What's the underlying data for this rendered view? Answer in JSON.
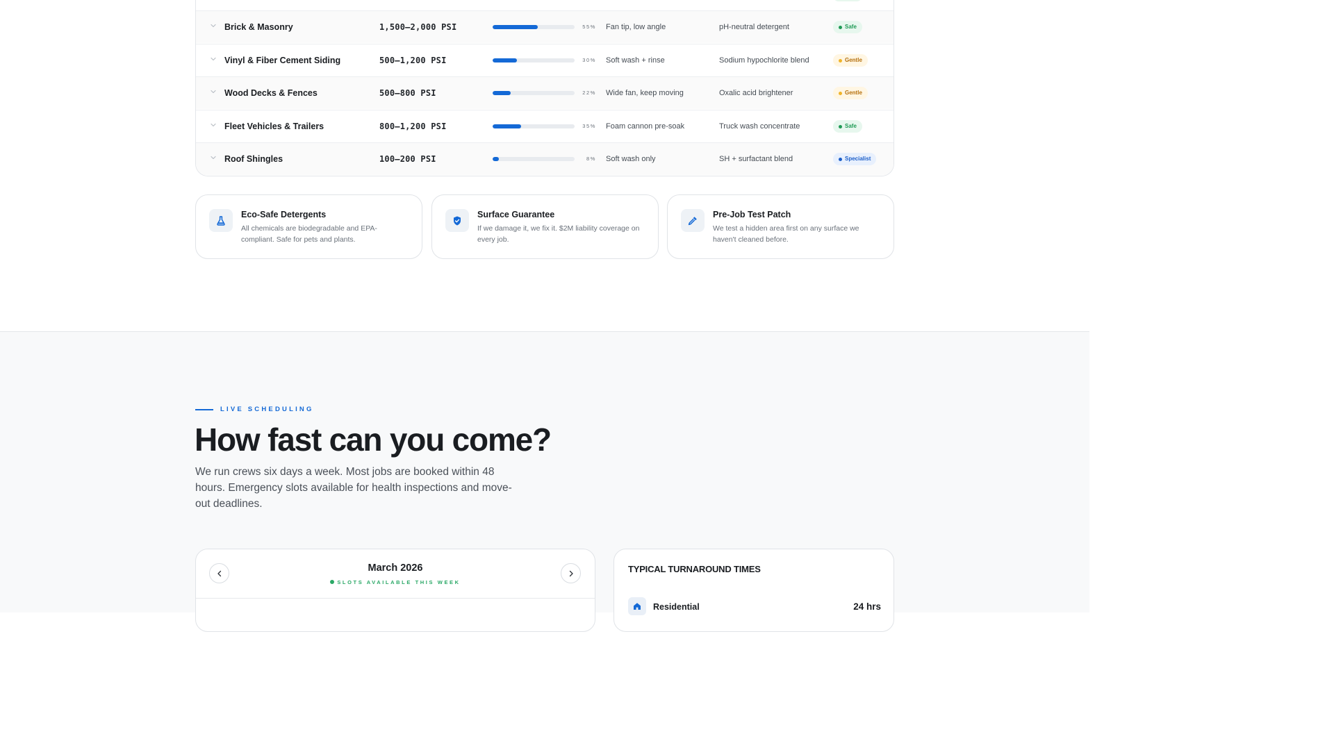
{
  "surfaces_table": {
    "rows": [
      {
        "surface": "Brick & Masonry",
        "psi": "1,500–2,000 PSI",
        "pressure_level": 55,
        "pressure_label": "55%",
        "technique": "Fan tip, low angle",
        "chemical": "pH-neutral detergent",
        "rating": "Safe",
        "rating_type": "safe"
      },
      {
        "surface": "Vinyl & Fiber Cement Siding",
        "psi": "500–1,200 PSI",
        "pressure_level": 30,
        "pressure_label": "30%",
        "technique": "Soft wash + rinse",
        "chemical": "Sodium hypochlorite blend",
        "rating": "Gentle",
        "rating_type": "gentle"
      },
      {
        "surface": "Wood Decks & Fences",
        "psi": "500–800 PSI",
        "pressure_level": 22,
        "pressure_label": "22%",
        "technique": "Wide fan, keep moving",
        "chemical": "Oxalic acid brightener",
        "rating": "Gentle",
        "rating_type": "gentle"
      },
      {
        "surface": "Fleet Vehicles & Trailers",
        "psi": "800–1,200 PSI",
        "pressure_level": 35,
        "pressure_label": "35%",
        "technique": "Foam cannon pre-soak",
        "chemical": "Truck wash concentrate",
        "rating": "Safe",
        "rating_type": "safe"
      },
      {
        "surface": "Roof Shingles",
        "psi": "100–200 PSI",
        "pressure_level": 8,
        "pressure_label": "8%",
        "technique": "Soft wash only",
        "chemical": "SH + surfactant blend",
        "rating": "Specialist",
        "rating_type": "specialist"
      }
    ]
  },
  "features": [
    {
      "icon": "flask-icon",
      "title": "Eco-Safe Detergents",
      "description": "All chemicals are biodegradable and EPA-compliant. Safe for pets and plants."
    },
    {
      "icon": "shield-icon",
      "title": "Surface Guarantee",
      "description": "If we damage it, we fix it. $2M liability coverage on every job."
    },
    {
      "icon": "dropper-icon",
      "title": "Pre-Job Test Patch",
      "description": "We test a hidden area first on any surface we haven't cleaned before."
    }
  ],
  "scheduling": {
    "eyebrow": "LIVE SCHEDULING",
    "headline": "How fast can you come?",
    "subtext": "We run crews six days a week. Most jobs are booked within 48 hours. Emergency slots available for health inspections and move-out deadlines.",
    "calendar": {
      "month": "March 2026",
      "status": "SLOTS AVAILABLE THIS WEEK",
      "prev_icon": "chevron-left-icon",
      "next_icon": "chevron-right-icon"
    },
    "turnaround": {
      "title": "TYPICAL TURNAROUND TIMES",
      "items": [
        {
          "icon": "home-icon",
          "label": "Residential",
          "value": "24 hrs"
        }
      ]
    }
  },
  "colors": {
    "accent": "#1469d6",
    "safe": "#1f9a55",
    "gentle": "#b5700d",
    "specialist": "#1c5ec9",
    "available": "#2aa866"
  }
}
